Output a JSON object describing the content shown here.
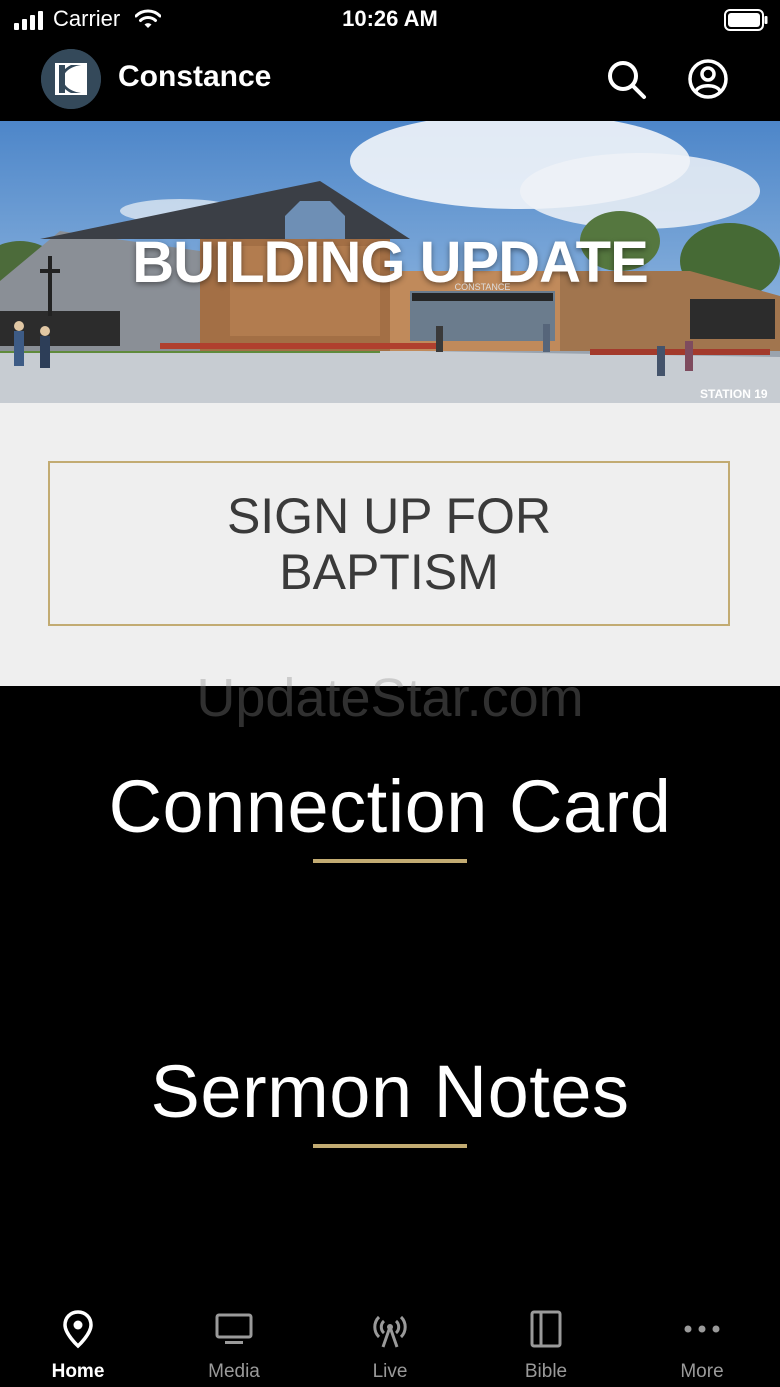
{
  "status_bar": {
    "carrier": "Carrier",
    "time": "10:26 AM"
  },
  "header": {
    "title": "Constance",
    "search_icon": "search-icon",
    "profile_icon": "user-circle-icon"
  },
  "hero": {
    "title": "BUILDING UPDATE",
    "sign_text": "CONSTANCE",
    "credit": "STATION 19"
  },
  "baptism": {
    "button_label": "SIGN UP FOR BAPTISM"
  },
  "watermark": "UpdateStar.com",
  "links": {
    "connection_card": "Connection Card",
    "sermon_notes": "Sermon Notes"
  },
  "tabs": [
    {
      "label": "Home",
      "icon": "map-pin-icon",
      "active": true
    },
    {
      "label": "Media",
      "icon": "monitor-icon",
      "active": false
    },
    {
      "label": "Live",
      "icon": "broadcast-icon",
      "active": false
    },
    {
      "label": "Bible",
      "icon": "book-icon",
      "active": false
    },
    {
      "label": "More",
      "icon": "more-dots-icon",
      "active": false
    }
  ],
  "colors": {
    "accent_gold": "#c2ab72",
    "background": "#000000",
    "panel": "#efefef"
  }
}
